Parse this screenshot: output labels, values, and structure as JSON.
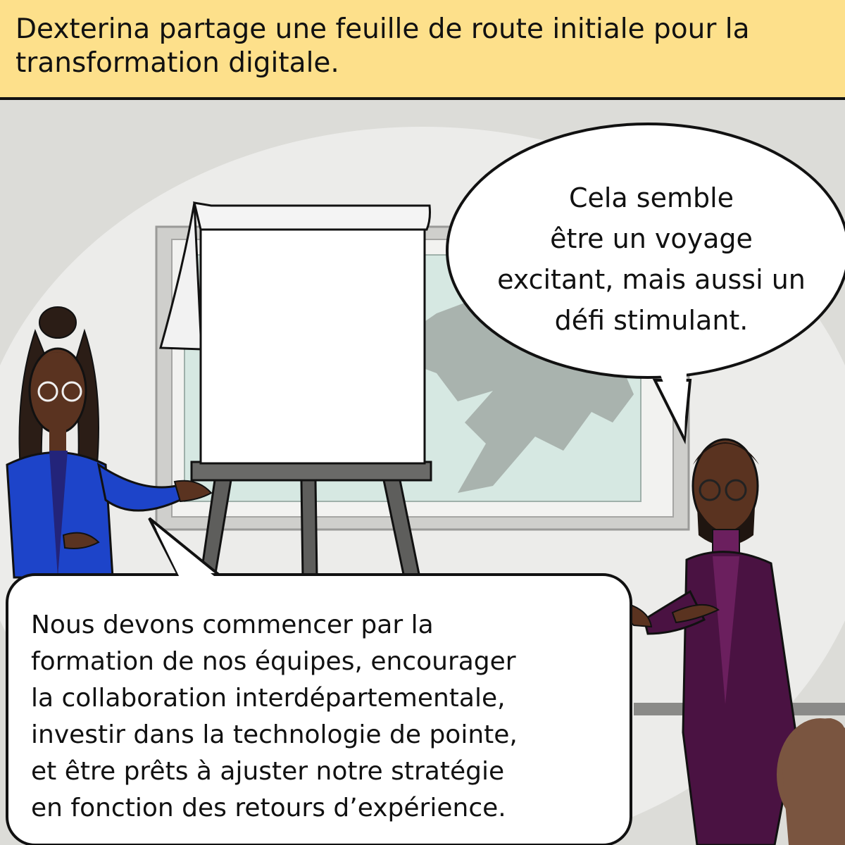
{
  "caption": {
    "lines": [
      "Dexterina partage une feuille de route initiale pour la",
      "transformation digitale."
    ]
  },
  "bubble_man": {
    "lines": [
      "Cela semble",
      "être un voyage",
      "excitant, mais aussi un",
      "défi stimulant."
    ]
  },
  "bubble_woman": {
    "lines": [
      "Nous devons commencer par la",
      "formation de nos équipes, encourager",
      "la collaboration interdépartementale,",
      "investir dans la technologie de pointe,",
      "et être prêts à ajuster notre stratégie",
      "en fonction des retours d’expérience."
    ]
  },
  "colors": {
    "caption_bg": "#fde08b",
    "wall": "#dcdcd8",
    "wall_light": "#ececea",
    "window_glass": "#d6e8e2",
    "mountain": "#a9b3ae",
    "woman_jacket": "#1d44c9",
    "man_suit": "#4a1242",
    "easel": "#5e5e5c"
  }
}
